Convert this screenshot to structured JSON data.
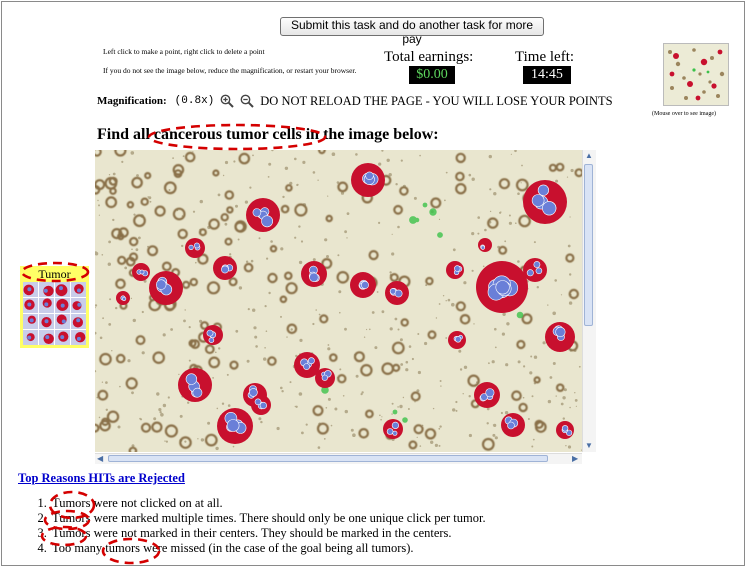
{
  "header": {
    "submit_label": "Submit this task and do another task for more pay",
    "instructions_line1": "Left click to make a point, right click to delete a point",
    "instructions_line2": "If you do not see the image below, reduce the magnification, or restart your browser.",
    "earnings_label": "Total earnings:",
    "earnings_value": "$0.00",
    "time_label": "Time left:",
    "time_value": "14:45",
    "thumbnail_caption": "(Mouse over to see image)"
  },
  "magnification": {
    "label": "Magnification:",
    "value": "(0.8x)",
    "zoom_in_icon": "zoom-in-icon",
    "zoom_out_icon": "zoom-out-icon",
    "warning": "DO NOT RELOAD THE PAGE - YOU WILL LOSE YOUR POINTS"
  },
  "task": {
    "title": "Find all cancerous tumor cells in the image below:"
  },
  "example": {
    "label": "Tumor"
  },
  "reasons": {
    "link": "Top Reasons HITs are Rejected",
    "items": [
      "Tumors were not clicked on at all.",
      "Tumors were marked multiple times. There should only be one unique click per tumor.",
      "Tumors were not marked in their centers. They should be marked in the centers.",
      "Too many tumors were missed (in the case of the goal being all tumors)."
    ]
  },
  "colors": {
    "annotation_red": "#d40000",
    "tumor_red": "#c8102e",
    "nucleus_blue": "#6a7fd8",
    "brown_stain": "#6b4a1c",
    "green_stain": "#3cc24a",
    "example_bg": "#ffff66",
    "earnings_text": "#5dd65d"
  }
}
